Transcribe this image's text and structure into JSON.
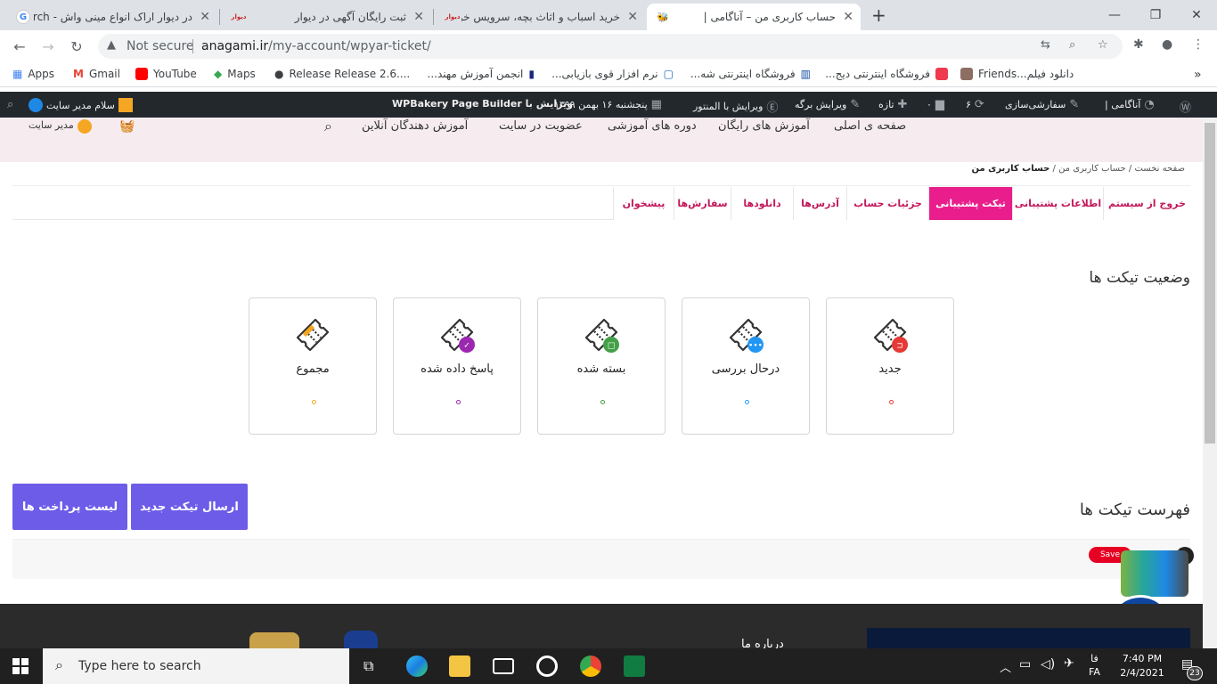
{
  "browser": {
    "tabs": [
      {
        "title": "در دیوار اراک انواع مینی واش - arch",
        "favicon": "G"
      },
      {
        "title": "ثبت رایگان آگهی در دیوار",
        "favicon": "دیوار"
      },
      {
        "title": "خرید اسباب و اثاث بچه، سرویس خو",
        "favicon": "دیوار"
      },
      {
        "title": "حساب کاربری من – آناگامی |",
        "favicon": "🐝"
      }
    ],
    "new_tab": "+",
    "security_label": "Not secure",
    "url_host": "anagami.ir",
    "url_path": "/my-account/wpyar-ticket/",
    "bookmarks": [
      "Apps",
      "Gmail",
      "YouTube",
      "Maps",
      "Release Release 2.6....",
      "انجمن آموزش مهند...",
      "نرم افزار قوی بازیابی...",
      "فروشگاه اینترنتی شه...",
      "فروشگاه اینترنتی دیج...",
      "Friends...دانلود فیلم"
    ],
    "bookmarks_more": "»"
  },
  "wp_admin_bar": {
    "site": "آناگامی |",
    "customize": "سفارشی‌سازی",
    "updates": "۶",
    "comments": "۰",
    "new": "تازه",
    "edit_page": "ویرایش برگه",
    "edit_elementor": "ویرایش با المنتور",
    "date": "پنجشنبه ۱۶ بهمن ۱۳۹۹",
    "wpbakery": "ویرایش با WPBakery Page Builder",
    "greeting": "سلام مدیر سایت"
  },
  "site_nav": {
    "user": "مدیر سایت",
    "items": [
      "صفحه ی اصلی",
      "آموزش های رایگان",
      "دوره های آموزشی",
      "عضویت در سایت",
      "آموزش دهندگان آنلاین"
    ]
  },
  "breadcrumb": {
    "home": "صفحه نخست",
    "sep": "/",
    "account": "حساب کاربری من",
    "current": "حساب کاربری من"
  },
  "account_tabs": [
    "خروج از سیستم",
    "اطلاعات پشتیبانی",
    "تیکت پشتیبانی",
    "جزئیات حساب",
    "آدرس‌ها",
    "دانلودها",
    "سفارش‌ها",
    "پیشخوان"
  ],
  "active_tab_index": 2,
  "ticket_status": {
    "title": "وضعیت تیکت ها",
    "cards": [
      {
        "label": "جدید",
        "badge_color": "#e53935",
        "badge": "⊐"
      },
      {
        "label": "درحال بررسی",
        "badge_color": "#2196f3",
        "badge": "•••"
      },
      {
        "label": "بسته شده",
        "badge_color": "#43a047",
        "badge": "□"
      },
      {
        "label": "پاسخ داده شده",
        "badge_color": "#9c27b0",
        "badge": "✓"
      },
      {
        "label": "مجموع",
        "badge_color": "#f5a623",
        "badge": ""
      }
    ]
  },
  "ticket_list": {
    "title": "فهرست تیکت ها",
    "new_ticket_button": "ارسال تیکت جدید",
    "payments_button": "لیست پرداخت ها"
  },
  "pinterest_save": "Save",
  "footer": {
    "about": "درباره ما"
  },
  "taskbar": {
    "search_placeholder": "Type here to search",
    "lang": "فا",
    "lang_code": "FA",
    "time": "7:40 PM",
    "date": "2/4/2021",
    "notifications": "23"
  },
  "colors": {
    "accent": "#e91e8c",
    "button": "#6d5ce8",
    "wp_bar": "#23282d"
  }
}
